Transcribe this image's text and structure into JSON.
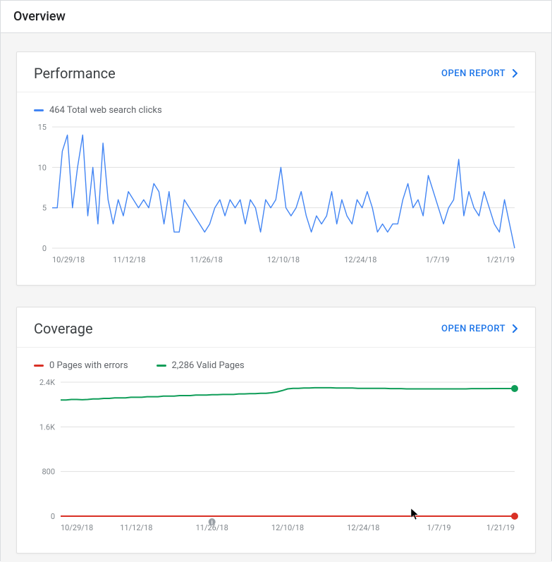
{
  "header": {
    "title": "Overview"
  },
  "cards": {
    "performance": {
      "title": "Performance",
      "open_report": "OPEN REPORT",
      "legend": {
        "series1": "464 Total web search clicks"
      },
      "colors": {
        "series1": "#4285f4"
      }
    },
    "coverage": {
      "title": "Coverage",
      "open_report": "OPEN REPORT",
      "legend": {
        "series1": "0 Pages with errors",
        "series2": "2,286 Valid Pages"
      },
      "colors": {
        "series1": "#d93025",
        "series2": "#0f9d58"
      }
    }
  },
  "chart_data": [
    {
      "type": "line",
      "title": "Performance",
      "ylabel": "",
      "xlabel": "",
      "ylim": [
        0,
        15
      ],
      "yticks": [
        0,
        5,
        10,
        15
      ],
      "xticks": [
        "10/29/18",
        "11/12/18",
        "11/26/18",
        "12/10/18",
        "12/24/18",
        "1/7/19",
        "1/21/19"
      ],
      "series": [
        {
          "name": "464 Total web search clicks",
          "color": "#4285f4",
          "values": [
            5,
            5,
            12,
            14,
            5,
            10,
            14,
            4,
            10,
            3,
            13,
            6,
            3,
            6,
            4,
            7,
            6,
            5,
            6,
            5,
            8,
            7,
            3,
            7,
            2,
            2,
            6,
            5,
            4,
            3,
            2,
            3,
            5,
            6,
            4,
            6,
            5,
            6,
            3,
            6,
            5,
            2,
            6,
            5,
            6,
            10,
            5,
            4,
            5,
            7,
            4,
            2,
            4,
            3,
            4,
            7,
            3,
            6,
            4,
            3,
            6,
            5,
            7,
            5,
            2,
            3,
            2,
            3,
            3,
            6,
            8,
            5,
            6,
            4,
            9,
            7,
            5,
            3,
            5,
            6,
            11,
            4,
            7,
            5,
            4,
            7,
            5,
            3,
            2,
            6,
            3,
            0
          ]
        }
      ]
    },
    {
      "type": "line",
      "title": "Coverage",
      "ylabel": "",
      "xlabel": "",
      "ylim": [
        0,
        2400
      ],
      "yticks_raw": [
        0,
        800,
        1600,
        2400
      ],
      "yticks": [
        "0",
        "800",
        "1.6K",
        "2.4K"
      ],
      "xticks": [
        "10/29/18",
        "11/12/18",
        "11/26/18",
        "12/10/18",
        "12/24/18",
        "1/7/19",
        "1/21/19"
      ],
      "series": [
        {
          "name": "0 Pages with errors",
          "color": "#d93025",
          "values": [
            0,
            0,
            0,
            0,
            0,
            0,
            0,
            0,
            0,
            0,
            0,
            0,
            0,
            0,
            0,
            0,
            0,
            0,
            0,
            0,
            0,
            0,
            0,
            0,
            0,
            0,
            0,
            0,
            0,
            0,
            0,
            0,
            0,
            0,
            0,
            0,
            0,
            0,
            0,
            0,
            0,
            0,
            0,
            0,
            0,
            0,
            0,
            0,
            0,
            0,
            0,
            0,
            0,
            0,
            0,
            0,
            0,
            0,
            0,
            0,
            0,
            0,
            0,
            0,
            0,
            0,
            0,
            0,
            0,
            0,
            0,
            0,
            0,
            0,
            0,
            0,
            0,
            0,
            0,
            0,
            0,
            0,
            0,
            0,
            0
          ]
        },
        {
          "name": "2,286 Valid Pages",
          "color": "#0f9d58",
          "values": [
            2080,
            2080,
            2090,
            2090,
            2085,
            2090,
            2100,
            2100,
            2110,
            2110,
            2120,
            2120,
            2120,
            2130,
            2130,
            2130,
            2140,
            2140,
            2140,
            2150,
            2150,
            2150,
            2160,
            2160,
            2160,
            2170,
            2170,
            2170,
            2175,
            2175,
            2180,
            2180,
            2180,
            2190,
            2190,
            2195,
            2195,
            2200,
            2200,
            2210,
            2225,
            2250,
            2280,
            2290,
            2290,
            2295,
            2295,
            2300,
            2300,
            2300,
            2300,
            2295,
            2295,
            2295,
            2295,
            2290,
            2290,
            2290,
            2290,
            2290,
            2290,
            2285,
            2285,
            2285,
            2280,
            2280,
            2280,
            2280,
            2280,
            2280,
            2280,
            2280,
            2280,
            2280,
            2280,
            2280,
            2285,
            2285,
            2285,
            2285,
            2286,
            2286,
            2286,
            2286,
            2286
          ]
        }
      ],
      "markers": [
        {
          "x_index": 28,
          "label": "event"
        }
      ],
      "endpoints": [
        {
          "series": 0,
          "color": "#d93025"
        },
        {
          "series": 1,
          "color": "#0f9d58"
        }
      ]
    }
  ]
}
